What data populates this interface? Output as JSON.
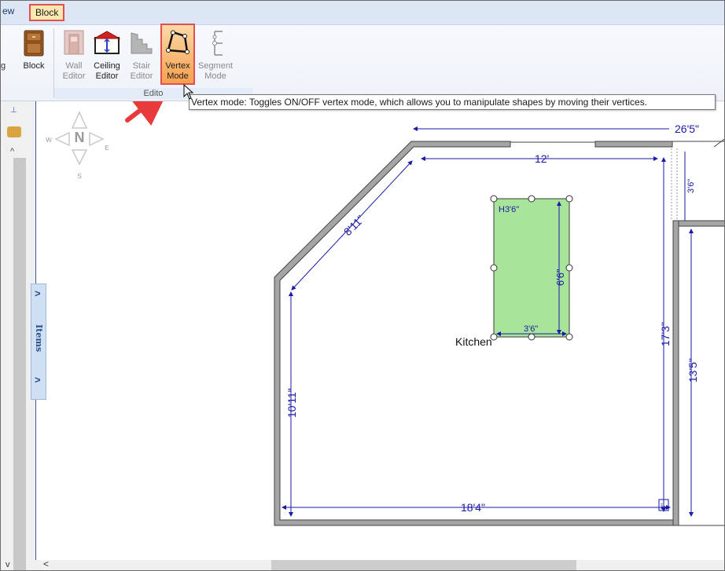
{
  "menu": {
    "view_tab": "ew",
    "block_tab": "Block"
  },
  "ribbon": {
    "block_label": "Block",
    "wall_editor": "Wall Editor",
    "ceiling_editor": "Ceiling Editor",
    "stair_editor": "Stair Editor",
    "vertex_mode": "Vertex Mode",
    "segment_mode": "Segment Mode",
    "group_label": "Edito",
    "prefix_label": "g"
  },
  "tooltip": "Vertex mode: Toggles ON/OFF vertex mode, which allows you to manipulate shapes by moving their vertices.",
  "side_tab": {
    "label": "Items"
  },
  "compass": {
    "n": "N",
    "w": "W",
    "e": "E",
    "s": "S"
  },
  "plan": {
    "room_label": "Kitchen",
    "dimensions": {
      "top_total": "26'5\"",
      "top_inner": "12'",
      "right_gap": "3'6\"",
      "diagonal": "8'11\"",
      "left_height": "10'11\"",
      "bottom_width": "18'4\"",
      "right_height": "17'3\"",
      "right_room_height": "13'5\"",
      "corner_small": "8\""
    },
    "island": {
      "height_label": "H3'6\"",
      "depth_label": "6'6\"",
      "width_label": "3'6\""
    }
  },
  "colors": {
    "dimension": "#1a1aa6",
    "island": "#a8e59a",
    "wall": "#9a9a9a",
    "highlight": "#e05050"
  }
}
